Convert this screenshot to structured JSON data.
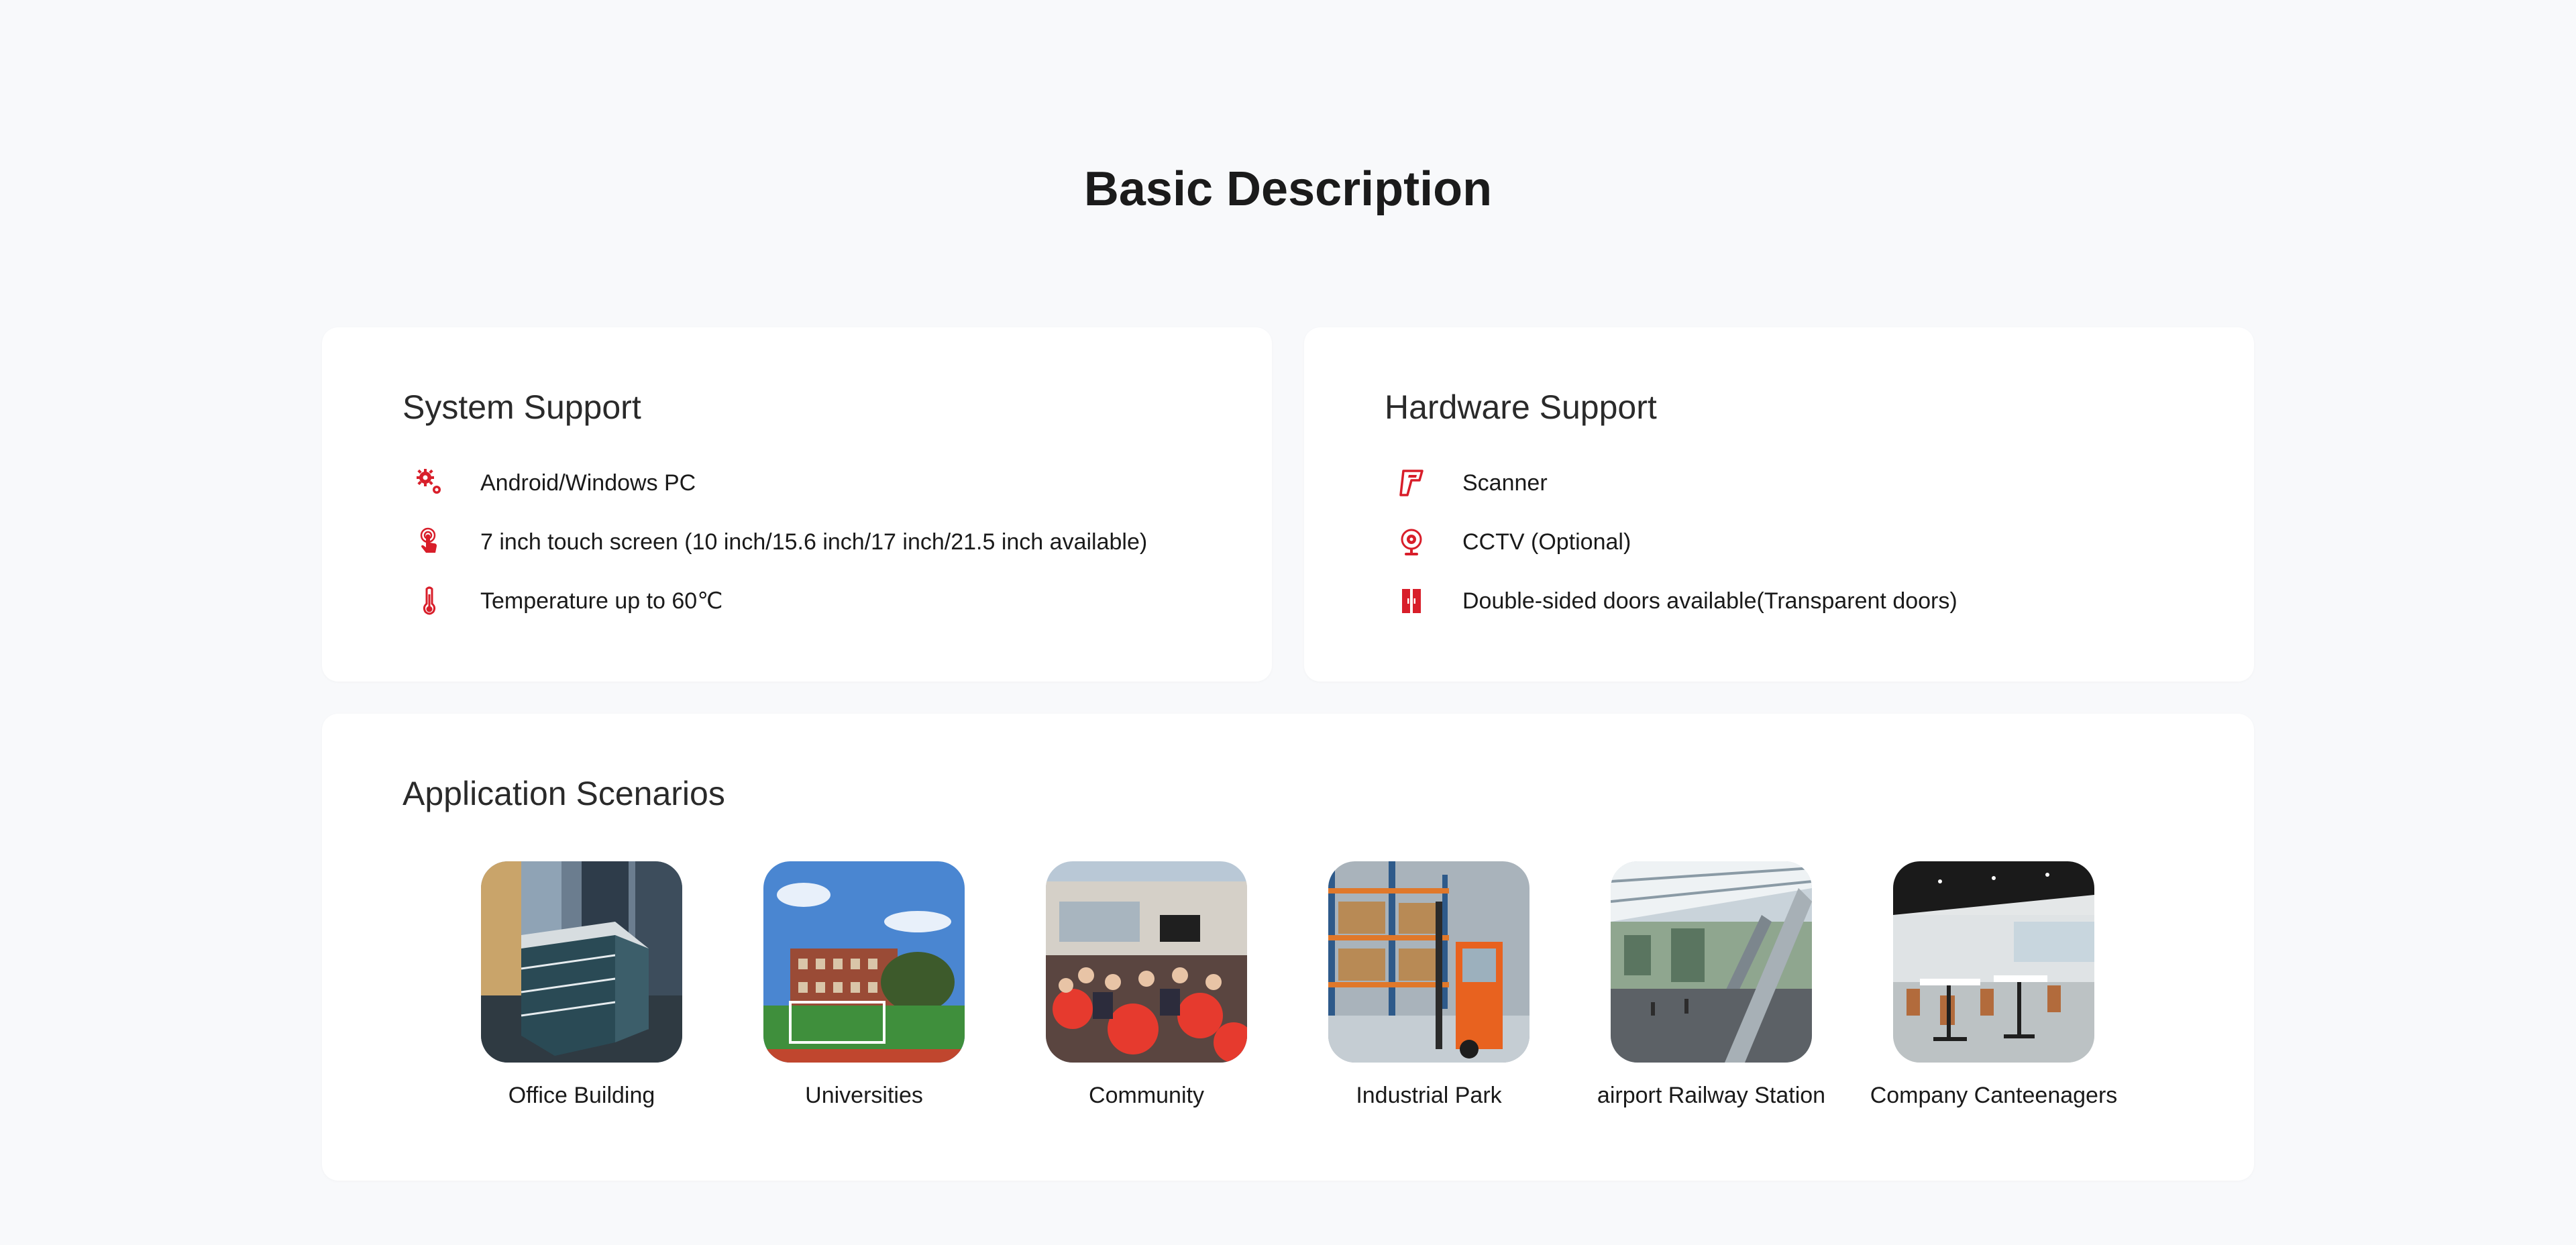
{
  "page": {
    "title": "Basic Description",
    "accent_color": "#d81e2a",
    "background_color": "#f8f9fb"
  },
  "system_support": {
    "title": "System Support",
    "items": [
      {
        "icon": "gears-icon",
        "text": "Android/Windows PC"
      },
      {
        "icon": "touch-icon",
        "text": "7 inch touch screen (10 inch/15.6 inch/17 inch/21.5 inch available)"
      },
      {
        "icon": "thermometer-icon",
        "text": "Temperature up to 60℃"
      }
    ]
  },
  "hardware_support": {
    "title": "Hardware Support",
    "items": [
      {
        "icon": "scanner-icon",
        "text": "Scanner"
      },
      {
        "icon": "cctv-camera-icon",
        "text": "CCTV (Optional)"
      },
      {
        "icon": "double-door-icon",
        "text": "Double-sided doors available(Transparent doors)"
      }
    ]
  },
  "application_scenarios": {
    "title": "Application Scenarios",
    "items": [
      {
        "image": "office-building-photo",
        "label": "Office Building"
      },
      {
        "image": "university-photo",
        "label": "Universities"
      },
      {
        "image": "community-photo",
        "label": "Community"
      },
      {
        "image": "industrial-park-photo",
        "label": "Industrial Park"
      },
      {
        "image": "airport-station-photo",
        "label": "airport Railway Station"
      },
      {
        "image": "canteen-photo",
        "label": "Company Canteenagers"
      }
    ]
  }
}
